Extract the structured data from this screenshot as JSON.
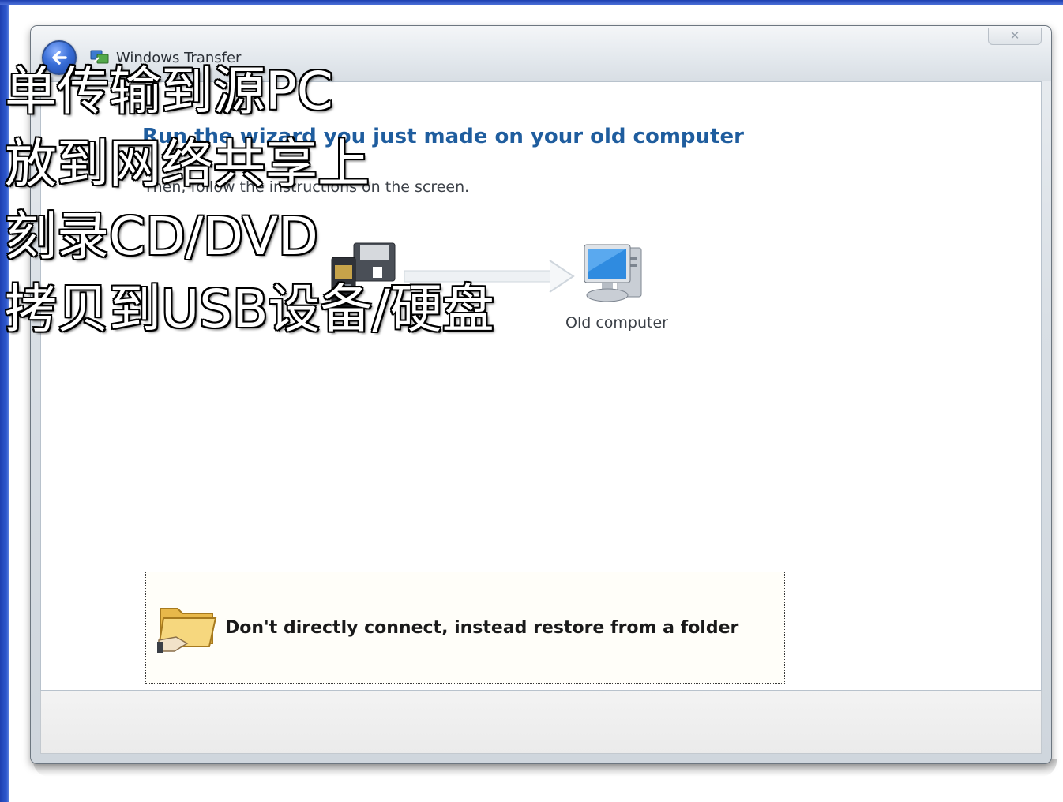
{
  "window": {
    "title": "Windows Transfer",
    "close_glyph": "✕"
  },
  "content": {
    "heading": "Run the wizard you just made on your old computer",
    "subtext": "Then, follow the instructions on the screen.",
    "target_label": "Old computer",
    "restore_option": "Don't directly connect, instead restore from a folder"
  },
  "overlay": {
    "lines": [
      "单传输到源PC",
      "放到网络共享上",
      "刻录CD/DVD",
      "拷贝到USB设备/硬盘"
    ]
  },
  "icons": {
    "back": "back-arrow-icon",
    "app": "windows-transfer-icon",
    "device": "removable-storage-icon",
    "arrow": "transfer-arrow-icon",
    "computer": "old-computer-icon",
    "folder": "restore-folder-icon"
  },
  "colors": {
    "heading": "#1f5d9e",
    "slide_blue": "#1d3fb0"
  }
}
